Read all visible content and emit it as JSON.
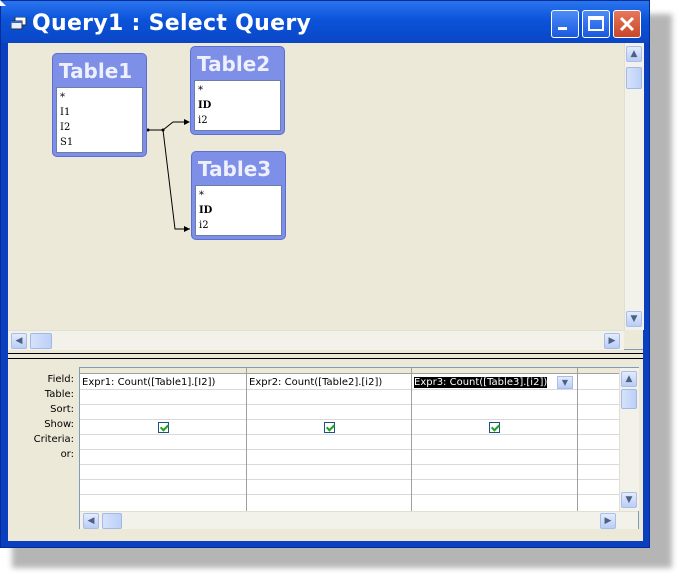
{
  "window": {
    "title": "Query1 : Select Query"
  },
  "design": {
    "tables": [
      {
        "name": "Table1",
        "fields": [
          "*",
          "I1",
          "I2",
          "S1"
        ],
        "bold": []
      },
      {
        "name": "Table2",
        "fields": [
          "*",
          "ID",
          "i2"
        ],
        "bold": [
          "ID"
        ]
      },
      {
        "name": "Table3",
        "fields": [
          "*",
          "ID",
          "i2"
        ],
        "bold": [
          "ID"
        ]
      }
    ]
  },
  "grid": {
    "row_labels": [
      "Field:",
      "Table:",
      "Sort:",
      "Show:",
      "Criteria:",
      "or:"
    ],
    "columns": [
      {
        "field": "Expr1: Count([Table1].[I2])",
        "show": true
      },
      {
        "field": "Expr2: Count([Table2].[i2])",
        "show": true
      },
      {
        "field": "Expr3: Count([Table3].[i2])",
        "show": true,
        "selected": true
      }
    ]
  },
  "colors": {
    "titlebar": "#0b53d9",
    "table_header": "#7d8fe6",
    "check": "#21a121"
  }
}
